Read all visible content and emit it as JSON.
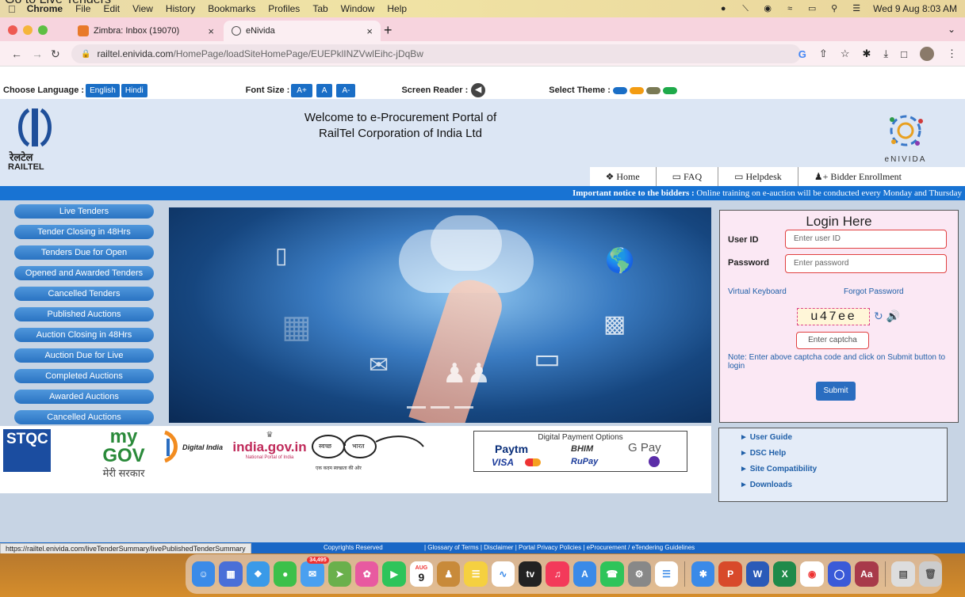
{
  "caption": "Go to Live Tenders",
  "menubar": {
    "app": "Chrome",
    "items": [
      "File",
      "Edit",
      "View",
      "History",
      "Bookmarks",
      "Profiles",
      "Tab",
      "Window",
      "Help"
    ],
    "clock": "Wed 9 Aug  8:03 AM"
  },
  "browser": {
    "tabs": [
      {
        "title": "Zimbra: Inbox (19070)"
      },
      {
        "title": "eNivida"
      }
    ],
    "url_host": "railtel.enivida.com",
    "url_path": "/HomePage/loadSiteHomePage/EUEPklINZVwlEihc-jDqBw"
  },
  "toolbar": {
    "choose_language": "Choose Language :",
    "lang_english": "English",
    "lang_hindi": "Hindi",
    "font_size": "Font Size :",
    "font_plus": "A+",
    "font_normal": "A",
    "font_minus": "A-",
    "screen_reader": "Screen Reader :",
    "select_theme": "Select Theme :",
    "theme_colors": [
      "#1a6ec6",
      "#f39c12",
      "#7a7a55",
      "#1eaa4a"
    ]
  },
  "header": {
    "title_line1": "Welcome to e-Procurement Portal of",
    "title_line2": "RailTel Corporation of India Ltd",
    "railtel_hindi": "रेलटेल",
    "railtel_en": "RAILTEL",
    "nivida": "eNIVIDA",
    "nav": {
      "home": "Home",
      "faq": "FAQ",
      "helpdesk": "Helpdesk",
      "bidder": "Bidder Enrollment"
    }
  },
  "notice": {
    "label": "Important notice to the bidders :",
    "text": " Online training on e-auction will be conducted every Monday and Thursday"
  },
  "sidebar": {
    "items": [
      {
        "label": "Live Tenders"
      },
      {
        "label": "Tender Closing in 48Hrs"
      },
      {
        "label": "Tenders Due for Open"
      },
      {
        "label": "Opened and Awarded Tenders"
      },
      {
        "label": "Cancelled Tenders"
      },
      {
        "label": "Published Auctions"
      },
      {
        "label": "Auction Closing in 48Hrs"
      },
      {
        "label": "Auction Due for Live"
      },
      {
        "label": "Completed Auctions"
      },
      {
        "label": "Awarded Auctions"
      },
      {
        "label": "Cancelled Auctions"
      }
    ]
  },
  "login": {
    "title": "Login Here",
    "user_label": "User ID",
    "user_placeholder": "Enter user ID",
    "pass_label": "Password",
    "pass_placeholder": "Enter password",
    "virtual_keyboard": "Virtual Keyboard",
    "forgot_password": "Forgot Password",
    "captcha_code": "u47ee",
    "captcha_placeholder": "Enter captcha",
    "note": "Note: Enter above captcha code and click on Submit button to login",
    "submit": "Submit"
  },
  "logos": {
    "stqc": "STQC",
    "mygov": "my GOV",
    "mygov_hindi": "मेरी सरकार",
    "digital_india": "Digital India",
    "india_gov": "india.gov.in",
    "india_gov_sub": "National Portal of India",
    "swachh_left": "स्वच्छ",
    "swachh_right": "भारत",
    "swachh_sub": "एक कदम स्वच्छता की ओर",
    "payment_title": "Digital Payment Options",
    "paytm": "Paytm",
    "bhim": "BHIM",
    "gpay": "G Pay",
    "visa": "VISA",
    "rupay": "RuPay"
  },
  "help": {
    "items": [
      "User Guide",
      "DSC Help",
      "Site Compatibility",
      "Downloads"
    ]
  },
  "footer": {
    "status_url": "https://railtel.enivida.com/liveTenderSummary/livePublishedTenderSummary",
    "copyright": "Copyrights Reserved",
    "links": "| Glossary of Terms | Disclaimer | Portal Privacy Policies | eProcurement / eTendering Guidelines"
  },
  "dock": {
    "mail_badge": "34,495",
    "calendar_month": "AUG",
    "calendar_day": "9"
  }
}
